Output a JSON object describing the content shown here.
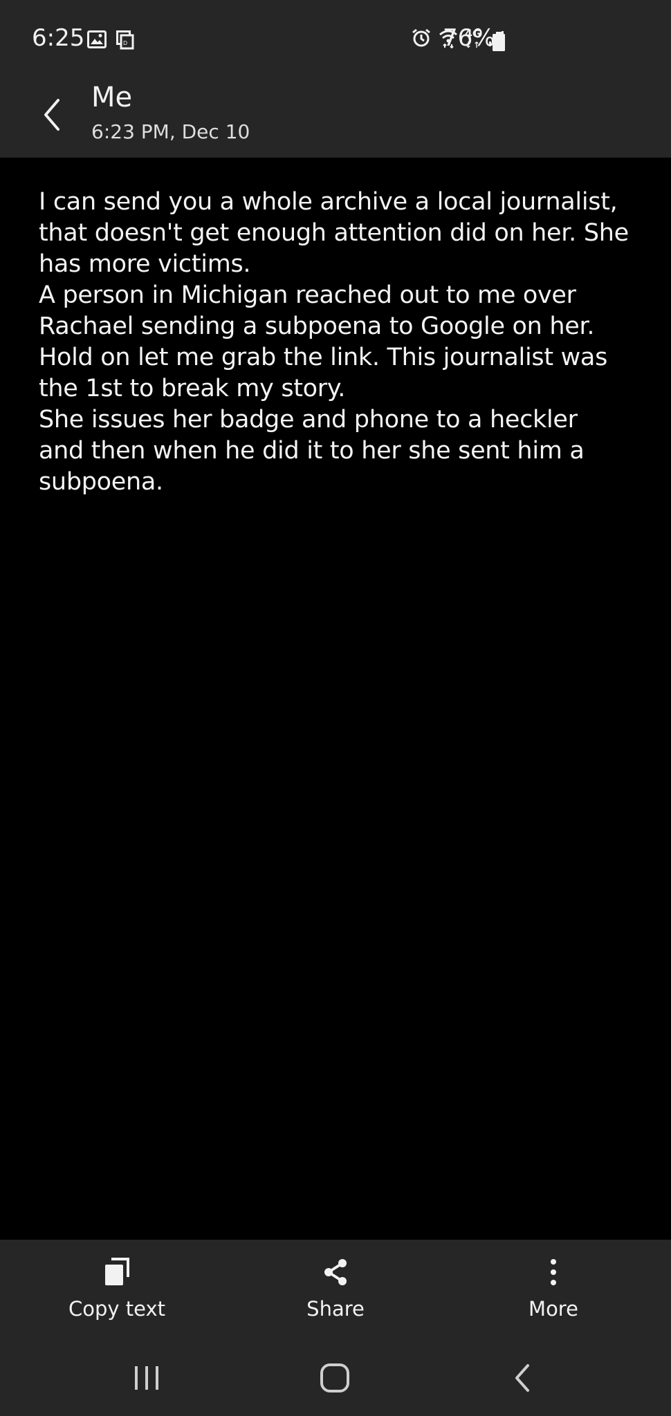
{
  "status_bar": {
    "time": "6:25",
    "network": "4G",
    "battery_percent": "76%",
    "icons": [
      "gallery-icon",
      "notification-icon",
      "alarm-icon",
      "wifi-icon",
      "4g-icon",
      "signal-icon",
      "battery-icon"
    ]
  },
  "header": {
    "title": "Me",
    "subtitle": "6:23 PM, Dec 10"
  },
  "message": {
    "text": "I can send you a whole archive a local journalist,\nthat doesn't get enough attention did on her. She\nhas more victims.\nA person in Michigan reached out to me over\nRachael sending a subpoena to Google on her.\nHold on let me grab the link. This journalist was\nthe 1st to break my story.\nShe issues her badge and phone to a heckler\nand then when he did it to her she sent him a\nsubpoena."
  },
  "actions": {
    "copy_label": "Copy text",
    "share_label": "Share",
    "more_label": "More"
  },
  "colors": {
    "bar_background": "#262626",
    "content_background": "#000000",
    "text": "#f2f2f2"
  }
}
